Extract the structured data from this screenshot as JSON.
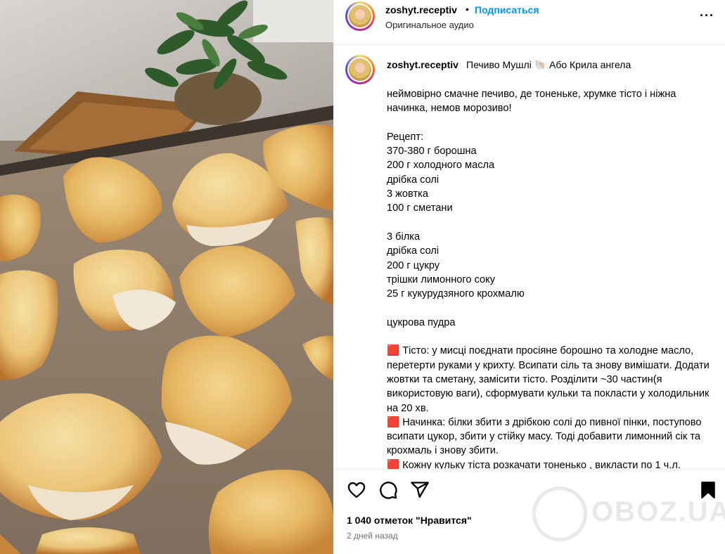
{
  "header": {
    "username": "zoshyt.receptiv",
    "separator": "•",
    "follow_label": "Подписаться",
    "audio_label": "Оригинальное аудио",
    "more_icon": "more-horizontal-icon",
    "more_glyph": "···"
  },
  "caption": {
    "username": "zoshyt.receptiv",
    "title": "Печиво Мушлі 🐚 Або Крила ангела",
    "body": "неймовірно смачне печиво, де тоненьке, хрумке тісто і ніжна начинка, немов морозиво!\n\nРецепт:\n370-380 г борошна\n200 г холодного масла\nдрібка солі\n3 жовтка\n100 г сметани\n\n3 білка\nдрібка солі\n200 г цукру\nтрішки лимонного соку\n25 г кукурудзяного крохмалю\n\nцукрова пудра\n\n🟥 Тісто: у мисці поєднати просіяне борошно та холодне масло, перетерти руками у крихту. Всипати сіль та знову вимішати. Додати жовтки та сметану, замісити тісто. Розділити ~30 частин(я використовую ваги), сформувати кульки та покласти у холодильник на 20 хв.\n🟥 Начинка: білки збити з дрібкою солі до пивної пінки, поступово всипати цукор, збити у стійку масу. Тоді добавити лимонний сік та крохмаль і знову збити.\n🟥 Кожну кульку тіста розкачати тоненько , викласти по 1 ч.л."
  },
  "actions": {
    "like_icon": "heart-icon",
    "comment_icon": "comment-icon",
    "share_icon": "share-icon",
    "save_icon": "bookmark-icon",
    "likes": "1 040 отметок \"Нравится\"",
    "time": "2 дней назад"
  },
  "watermark": {
    "text": "OBOZ.UA"
  },
  "colors": {
    "accent": "#0095f6",
    "border": "#efefef",
    "secondary_text": "#737373"
  }
}
